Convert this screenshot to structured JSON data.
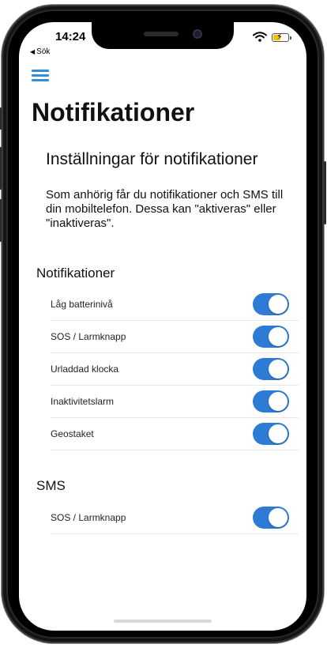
{
  "status_bar": {
    "time": "14:24",
    "back_label": "Sök"
  },
  "colors": {
    "accent": "#2e7bd6",
    "menu_icon": "#2f8fd8",
    "battery_fill": "#f5c400"
  },
  "header": {
    "menu_icon": "hamburger-menu-icon",
    "title": "Notifikationer"
  },
  "intro": {
    "heading": "Inställningar för notifikationer",
    "text": "Som anhörig får du notifikationer och SMS till din mobiltelefon. Dessa kan \"aktiveras\" eller \"inaktiveras\"."
  },
  "notifications": {
    "title": "Notifikationer",
    "items": [
      {
        "label": "Låg batterinivå",
        "enabled": true
      },
      {
        "label": "SOS / Larmknapp",
        "enabled": true
      },
      {
        "label": "Urladdad klocka",
        "enabled": true
      },
      {
        "label": "Inaktivitetslarm",
        "enabled": true
      },
      {
        "label": "Geostaket",
        "enabled": true
      }
    ]
  },
  "sms": {
    "title": "SMS",
    "items": [
      {
        "label": "SOS / Larmknapp",
        "enabled": true
      }
    ]
  }
}
